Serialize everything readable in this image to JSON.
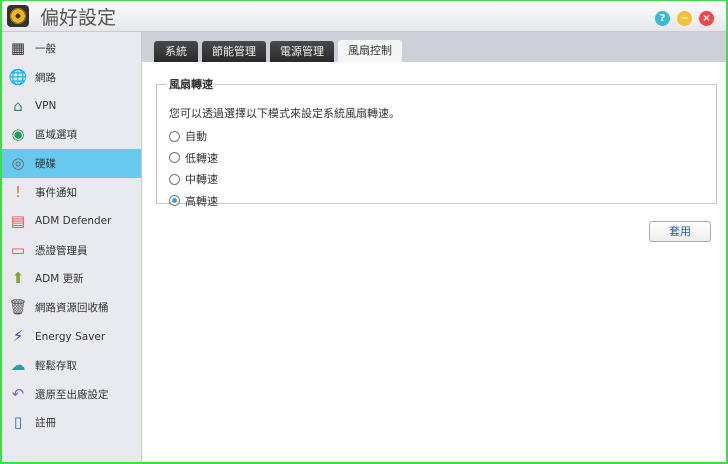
{
  "window": {
    "title": "偏好設定",
    "help_icon": "?",
    "minimize_icon": "−",
    "close_icon": "×"
  },
  "sidebar": {
    "items": [
      {
        "label": "一般",
        "icon": "server-icon",
        "glyph": "▦",
        "color": "#333"
      },
      {
        "label": "網路",
        "icon": "globe-icon",
        "glyph": "🌐",
        "color": "#1f8a8a"
      },
      {
        "label": "VPN",
        "icon": "house-network-icon",
        "glyph": "⌂",
        "color": "#3a8a6a"
      },
      {
        "label": "區域選項",
        "icon": "region-globe-icon",
        "glyph": "◉",
        "color": "#2a9a5a"
      },
      {
        "label": "硬碟",
        "icon": "disk-icon",
        "glyph": "◎",
        "color": "#666"
      },
      {
        "label": "事件通知",
        "icon": "alert-icon",
        "glyph": "!",
        "color": "#d9820f"
      },
      {
        "label": "ADM Defender",
        "icon": "firewall-icon",
        "glyph": "▤",
        "color": "#e84a4a"
      },
      {
        "label": "憑證管理員",
        "icon": "certificate-icon",
        "glyph": "▭",
        "color": "#e05060"
      },
      {
        "label": "ADM 更新",
        "icon": "update-arrow-icon",
        "glyph": "⬆",
        "color": "#7aa52a"
      },
      {
        "label": "網路資源回收桶",
        "icon": "trash-icon",
        "glyph": "🗑",
        "color": "#555"
      },
      {
        "label": "Energy Saver",
        "icon": "lightning-icon",
        "glyph": "⚡",
        "color": "#2a4ad0"
      },
      {
        "label": "輕鬆存取",
        "icon": "cloud-upload-icon",
        "glyph": "☁",
        "color": "#2aa0a0"
      },
      {
        "label": "還原至出廠設定",
        "icon": "undo-icon",
        "glyph": "↶",
        "color": "#7a6ad0"
      },
      {
        "label": "註冊",
        "icon": "register-icon",
        "glyph": "▯",
        "color": "#2a70c0"
      }
    ],
    "selected": 4,
    "accent": "#68c9ef"
  },
  "tabs": [
    {
      "label": "系統"
    },
    {
      "label": "節能管理"
    },
    {
      "label": "電源管理"
    },
    {
      "label": "風扇控制"
    }
  ],
  "active_tab": 3,
  "fan": {
    "legend": "風扇轉速",
    "description": "您可以透過選擇以下模式來設定系統風扇轉速。",
    "options": [
      {
        "label": "自動",
        "checked": false
      },
      {
        "label": "低轉速",
        "checked": false
      },
      {
        "label": "中轉速",
        "checked": false
      },
      {
        "label": "高轉速",
        "checked": true
      }
    ]
  },
  "apply_label": "套用"
}
